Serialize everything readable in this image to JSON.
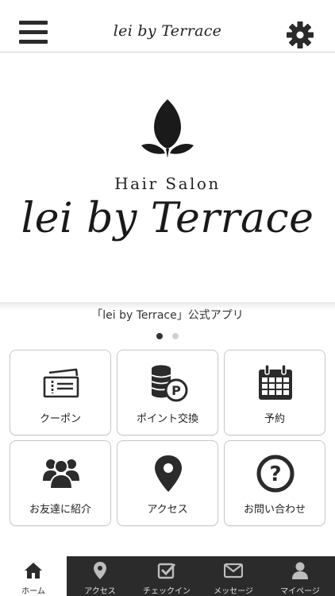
{
  "header": {
    "title": "lei by Terrace",
    "menu_icon": "menu-icon",
    "settings_icon": "gear-icon"
  },
  "hero": {
    "subtitle": "Hair Salon",
    "title": "lei by Terrace",
    "caption": "「lei by Terrace」公式アプリ",
    "slide_count": 2,
    "active_slide": 1
  },
  "tiles": [
    {
      "label": "クーポン",
      "icon": "ticket-icon"
    },
    {
      "label": "ポイント交換",
      "icon": "coins-icon"
    },
    {
      "label": "予約",
      "icon": "calendar-icon"
    },
    {
      "label": "お友達に紹介",
      "icon": "users-icon"
    },
    {
      "label": "アクセス",
      "icon": "map-pin-icon"
    },
    {
      "label": "お問い合わせ",
      "icon": "question-icon"
    }
  ],
  "tabbar": [
    {
      "label": "ホーム",
      "icon": "home-icon",
      "active": true
    },
    {
      "label": "アクセス",
      "icon": "map-pin-icon",
      "active": false
    },
    {
      "label": "チェックイン",
      "icon": "checkin-icon",
      "active": false
    },
    {
      "label": "メッセージ",
      "icon": "mail-icon",
      "active": false
    },
    {
      "label": "マイページ",
      "icon": "person-icon",
      "active": false
    }
  ],
  "colors": {
    "icon": "#2b2b2b",
    "tabbar_bg": "#2b2b2b",
    "tab_active_bg": "#ffffff",
    "tile_border": "#c8c8c8"
  }
}
